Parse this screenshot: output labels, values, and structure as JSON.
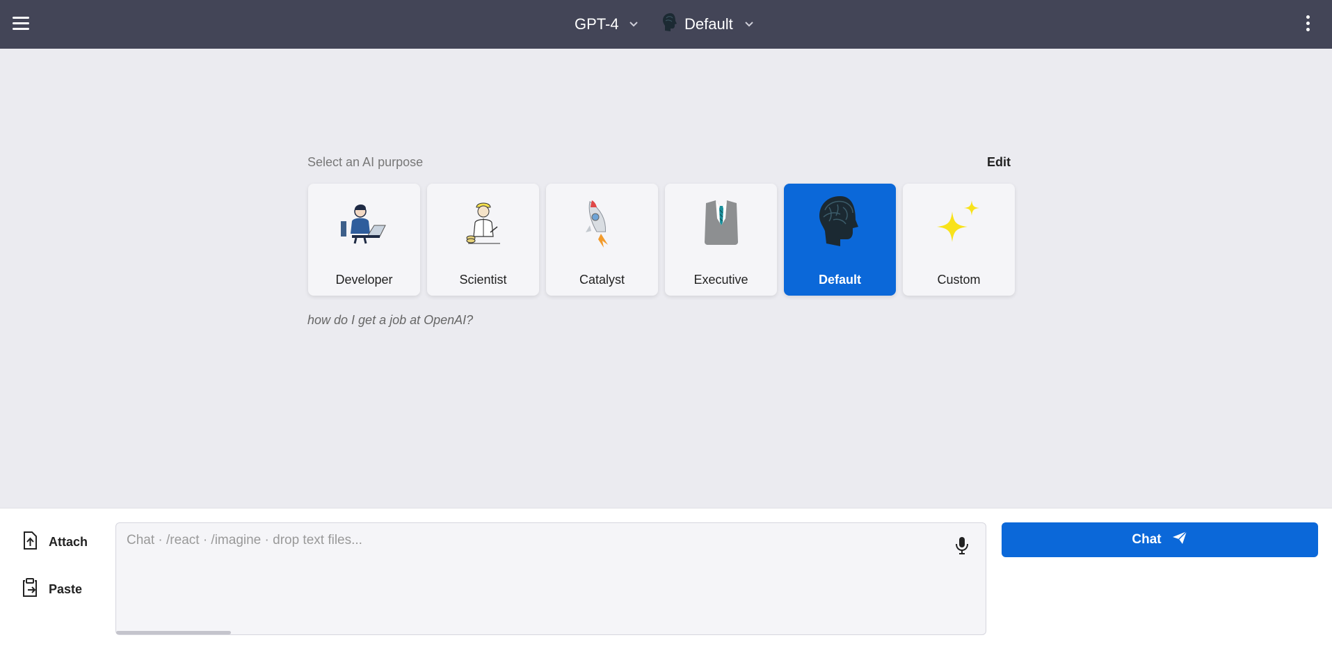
{
  "header": {
    "model": "GPT-4",
    "persona": "Default"
  },
  "purpose": {
    "label": "Select an AI purpose",
    "edit_label": "Edit",
    "cards": [
      {
        "label": "Developer",
        "icon": "developer-icon",
        "selected": false
      },
      {
        "label": "Scientist",
        "icon": "scientist-icon",
        "selected": false
      },
      {
        "label": "Catalyst",
        "icon": "rocket-icon",
        "selected": false
      },
      {
        "label": "Executive",
        "icon": "suit-icon",
        "selected": false
      },
      {
        "label": "Default",
        "icon": "brain-head-icon",
        "selected": true
      },
      {
        "label": "Custom",
        "icon": "sparkles-icon",
        "selected": false
      }
    ],
    "example": "how do I get a job at OpenAI?"
  },
  "composer": {
    "attach_label": "Attach",
    "paste_label": "Paste",
    "placeholder": "Chat · /react · /imagine · drop text files...",
    "value": "",
    "send_label": "Chat"
  },
  "colors": {
    "topbar": "#434557",
    "background": "#ebebf0",
    "accent": "#0b68d9"
  }
}
